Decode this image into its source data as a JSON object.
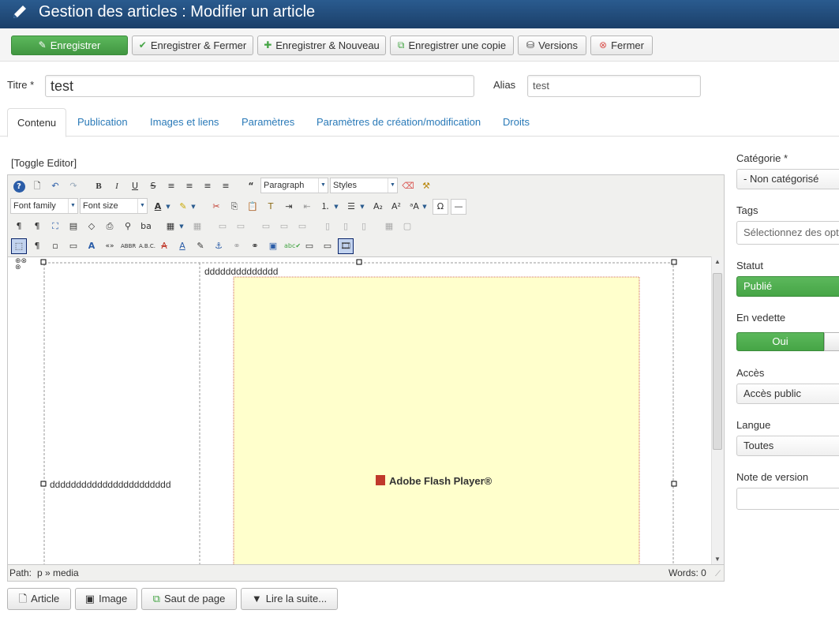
{
  "header": {
    "title": "Gestion des articles : Modifier un article",
    "icon": "pencil-icon"
  },
  "toolbar": {
    "save": "Enregistrer",
    "save_close": "Enregistrer & Fermer",
    "save_new": "Enregistrer & Nouveau",
    "save_copy": "Enregistrer une copie",
    "versions": "Versions",
    "close": "Fermer"
  },
  "form": {
    "title_label": "Titre *",
    "title_value": "test",
    "alias_label": "Alias",
    "alias_value": "test"
  },
  "tabs": [
    "Contenu",
    "Publication",
    "Images et liens",
    "Paramètres",
    "Paramètres de création/modification",
    "Droits"
  ],
  "editor": {
    "toggle": "[Toggle Editor]",
    "format_select": "Paragraph",
    "styles_select": "Styles",
    "font_family_select": "Font family",
    "font_size_select": "Font size",
    "content_text_top": "dddddddddddddd",
    "content_text_left": "ddddddddddddddddddddddd",
    "flash_label": "Adobe Flash Player®",
    "path_label": "Path:",
    "path_value": "p » media",
    "words": "Words: 0"
  },
  "bottom_buttons": {
    "article": "Article",
    "image": "Image",
    "pagebreak": "Saut de page",
    "readmore": "Lire la suite..."
  },
  "sidebar": {
    "category_label": "Catégorie *",
    "category_value": "- Non catégorisé",
    "tags_label": "Tags",
    "tags_placeholder": "Sélectionnez des opti",
    "status_label": "Statut",
    "status_value": "Publié",
    "featured_label": "En vedette",
    "featured_yes": "Oui",
    "access_label": "Accès",
    "access_value": "Accès public",
    "language_label": "Langue",
    "language_value": "Toutes",
    "version_note_label": "Note de version"
  },
  "colors": {
    "header": "#1b3f69",
    "save_green": "#46a546",
    "tab_link": "#2a7ab8",
    "status_green": "#46a546"
  }
}
